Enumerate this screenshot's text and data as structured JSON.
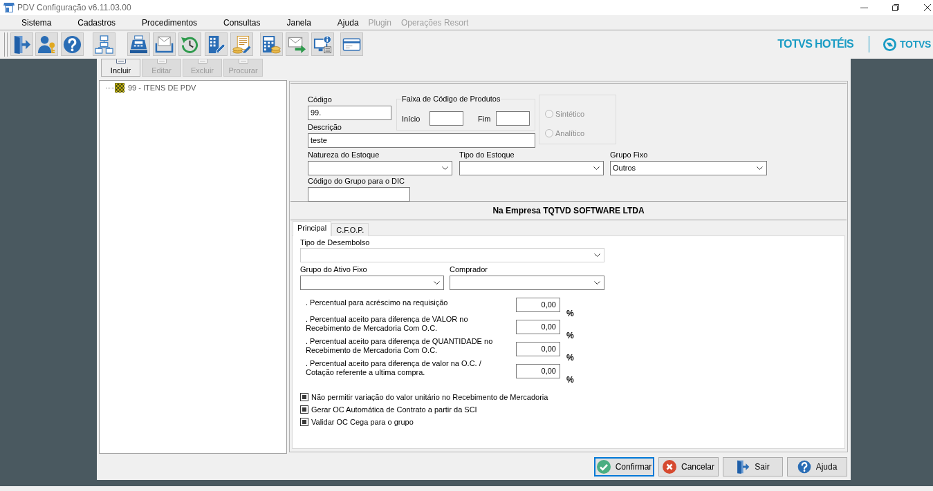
{
  "window": {
    "title": "PDV Configuração v6.11.03.00"
  },
  "menu": [
    {
      "label": "Sistema",
      "disabled": false
    },
    {
      "label": "Cadastros",
      "disabled": false
    },
    {
      "label": "Procedimentos",
      "disabled": false
    },
    {
      "label": "Consultas",
      "disabled": false
    },
    {
      "label": "Janela",
      "disabled": false
    },
    {
      "label": "Ajuda",
      "disabled": false
    },
    {
      "label": "Plugin",
      "disabled": true
    },
    {
      "label": "Operações Resort",
      "disabled": true
    }
  ],
  "brand": {
    "product": "TOTVS HOTÉIS",
    "company": "TOTVS"
  },
  "record_toolbar": [
    {
      "label": "Incluir",
      "disabled": false
    },
    {
      "label": "Editar",
      "disabled": true
    },
    {
      "label": "Excluir",
      "disabled": true
    },
    {
      "label": "Procurar",
      "disabled": true
    }
  ],
  "tree": [
    {
      "label": "99 - ITENS DE PDV"
    }
  ],
  "main_form": {
    "code": {
      "label": "Código",
      "value": "99."
    },
    "product_range": {
      "title": "Faixa de Código de Produtos",
      "start": {
        "label": "Início"
      },
      "end": {
        "label": "Fim"
      }
    },
    "type_options": [
      {
        "label": "Sintético",
        "selected": false,
        "disabled": true
      },
      {
        "label": "Analítico",
        "selected": false,
        "disabled": true
      }
    ],
    "description": {
      "label": "Descrição",
      "value": "teste"
    },
    "stock_nature": {
      "label": "Natureza do Estoque"
    },
    "stock_type": {
      "label": "Tipo do Estoque"
    },
    "fixed_group": {
      "label": "Grupo Fixo",
      "value": "Outros"
    },
    "dic_group_code": {
      "label": "Código do Grupo para o DIC"
    }
  },
  "company_header": "Na Empresa TQTVD SOFTWARE LTDA",
  "tabs": [
    {
      "label": "Principal",
      "selected": true
    },
    {
      "label": "C.F.O.P.",
      "selected": false
    }
  ],
  "principal": {
    "disbursement_type": {
      "label": "Tipo de Desembolso",
      "disabled": true
    },
    "fixed_asset_group": {
      "label": "Grupo do Ativo Fixo",
      "disabled": false
    },
    "buyer": {
      "label": "Comprador",
      "disabled": false
    },
    "percentages": [
      {
        "label": ". Percentual para acréscimo na requisição",
        "value": "0,00",
        "unit": "%"
      },
      {
        "label": ". Percentual aceito para diferença de VALOR no\nRecebimento de Mercadoria Com O.C.",
        "value": "0,00",
        "unit": "%"
      },
      {
        "label": ". Percentual aceito para diferença de QUANTIDADE no\nRecebimento de Mercadoria Com O.C.",
        "value": "0,00",
        "unit": "%"
      },
      {
        "label": ". Percentual aceito para diferença de valor na O.C. /\nCotação referente a ultima compra.",
        "value": "0,00",
        "unit": "%"
      }
    ],
    "options": [
      {
        "label": "Não permitir variação do valor unitário no Recebimento de Mercadoria",
        "checked": true
      },
      {
        "label": "Gerar OC Automática de Contrato a partir da SCI",
        "checked": true
      },
      {
        "label": "Validar OC Cega para o grupo",
        "checked": true
      }
    ]
  },
  "buttons": [
    {
      "label": "Confirmar",
      "focused": true
    },
    {
      "label": "Cancelar",
      "focused": false
    },
    {
      "label": "Sair",
      "focused": false
    },
    {
      "label": "Ajuda",
      "focused": false
    }
  ]
}
